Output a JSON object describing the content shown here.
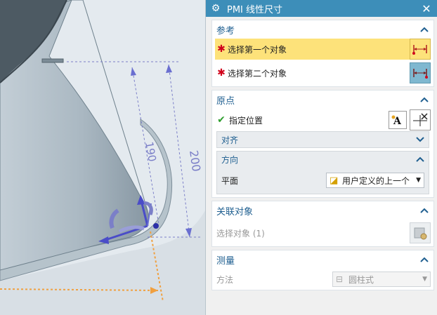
{
  "viewport": {
    "dims": {
      "d200": "200",
      "d190": "190"
    }
  },
  "dialog": {
    "title": "PMI 线性尺寸",
    "close": "✕",
    "reference": {
      "title": "参考",
      "first": "选择第一个对象",
      "second": "选择第二个对象"
    },
    "origin": {
      "title": "原点",
      "specify": "指定位置",
      "align": "对齐",
      "direction": "方向",
      "plane_label": "平面",
      "plane_value": "用户定义的上一个"
    },
    "related": {
      "title": "关联对象",
      "select": "选择对象 (1)"
    },
    "measure": {
      "title": "测量",
      "method_label": "方法",
      "method_value": "圆柱式"
    }
  },
  "colors": {
    "title_bar": "#3d8eb9",
    "section_title": "#1f5f90",
    "highlight": "#fde27a",
    "required_star": "#d0021b",
    "check": "#2e9e2e"
  }
}
